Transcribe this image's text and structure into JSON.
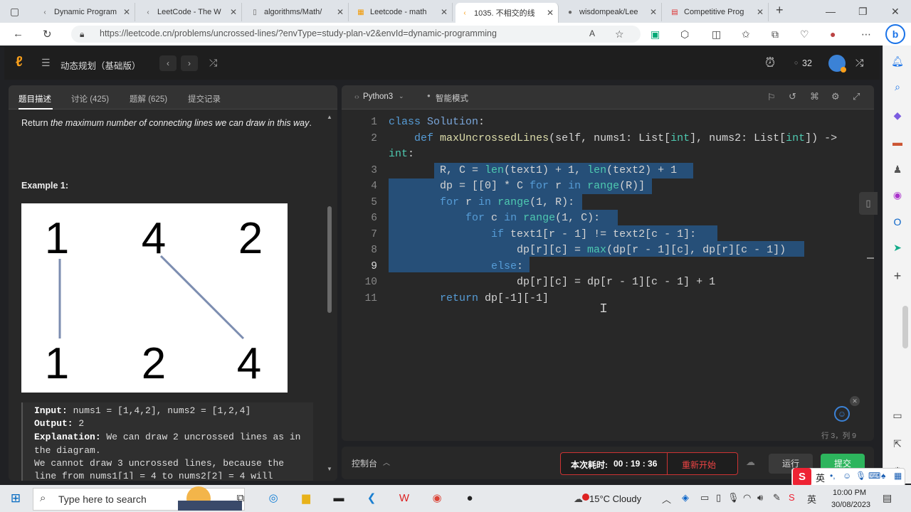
{
  "browser": {
    "tabs": [
      {
        "title": "Dynamic Program",
        "icon": "chevron-left-icon"
      },
      {
        "title": "LeetCode - The W",
        "icon": "chevron-left-icon"
      },
      {
        "title": "algorithms/Math/",
        "icon": "document-icon"
      },
      {
        "title": "Leetcode - math",
        "icon": "sheets-icon"
      },
      {
        "title": "1035. 不相交的线",
        "icon": "leetcode-icon"
      },
      {
        "title": "wisdompeak/Lee",
        "icon": "github-icon"
      },
      {
        "title": "Competitive Prog",
        "icon": "pdf-icon"
      }
    ],
    "url": "https://leetcode.cn/problems/uncrossed-lines/?envType=study-plan-v2&envId=dynamic-programming",
    "notif_count": "0"
  },
  "header": {
    "plan_title": "动态规划（基础版）",
    "counter": "32"
  },
  "left_tabs": [
    {
      "label": "题目描述"
    },
    {
      "label": "讨论 (425)"
    },
    {
      "label": "题解 (625)"
    },
    {
      "label": "提交记录"
    }
  ],
  "description": {
    "return_prefix": "Return ",
    "return_italic": "the maximum number of connecting lines we can draw in this way",
    "return_suffix": ".",
    "example_title": "Example 1:",
    "diagram": {
      "top": [
        "1",
        "4",
        "2"
      ],
      "bottom": [
        "1",
        "2",
        "4"
      ]
    },
    "input_label": "Input:",
    "input_value": " nums1 = [1,4,2], nums2 = [1,2,4]",
    "output_label": "Output:",
    "output_value": " 2",
    "explanation_label": "Explanation:",
    "explanation_1": " We can draw 2 uncrossed lines as in",
    "explanation_2": "the diagram.",
    "explanation_3": "We cannot draw 3 uncrossed lines, because the",
    "explanation_4": "line from nums1[1] = 4 to nums2[2] = 4 will"
  },
  "editor": {
    "language": "Python3",
    "mode": "智能模式",
    "line_numbers": [
      "1",
      "2",
      "3",
      "4",
      "5",
      "6",
      "7",
      "8",
      "9",
      "10",
      "11"
    ],
    "cursor_pos": "行 3，列 9"
  },
  "console": {
    "label": "控制台",
    "timer_label": "本次耗时: ",
    "timer_value": "00 : 19 : 36",
    "restart": "重新开始",
    "run": "运行",
    "submit": "提交"
  },
  "taskbar": {
    "search_placeholder": "Type here to search",
    "weather": "15°C  Cloudy",
    "time": "10:00 PM",
    "date": "30/08/2023",
    "ime": "英"
  }
}
